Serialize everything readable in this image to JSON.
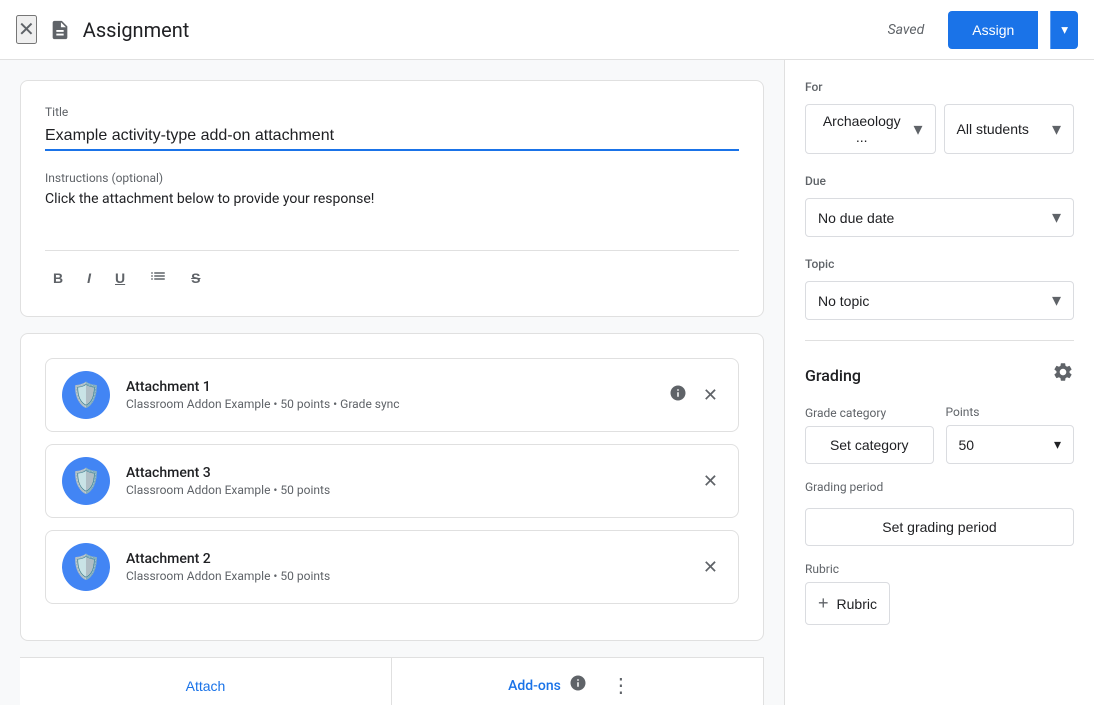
{
  "header": {
    "title": "Assignment",
    "saved_text": "Saved",
    "assign_label": "Assign"
  },
  "form": {
    "title_label": "Title",
    "title_value": "Example activity-type add-on attachment",
    "instructions_label": "Instructions (optional)",
    "instructions_text": "Click the attachment below to provide your response!",
    "toolbar": {
      "bold": "B",
      "italic": "I",
      "underline": "U",
      "list": "≡",
      "strikethrough": "S̶"
    }
  },
  "attachments": [
    {
      "name": "Attachment 1",
      "meta": "Classroom Addon Example • 50 points • Grade sync"
    },
    {
      "name": "Attachment 3",
      "meta": "Classroom Addon Example • 50 points"
    },
    {
      "name": "Attachment 2",
      "meta": "Classroom Addon Example • 50 points"
    }
  ],
  "bottom_bar": {
    "attach_label": "Attach",
    "addons_label": "Add-ons"
  },
  "right_panel": {
    "for_label": "For",
    "class_value": "Archaeology ...",
    "students_value": "All students",
    "due_label": "Due",
    "due_value": "No due date",
    "topic_label": "Topic",
    "topic_value": "No topic",
    "grading_label": "Grading",
    "grade_category_label": "Grade category",
    "points_label": "Points",
    "set_category_label": "Set category",
    "points_value": "50",
    "grading_period_label": "Grading period",
    "set_grading_period_label": "Set grading period",
    "rubric_label": "Rubric",
    "add_rubric_label": "Rubric"
  }
}
